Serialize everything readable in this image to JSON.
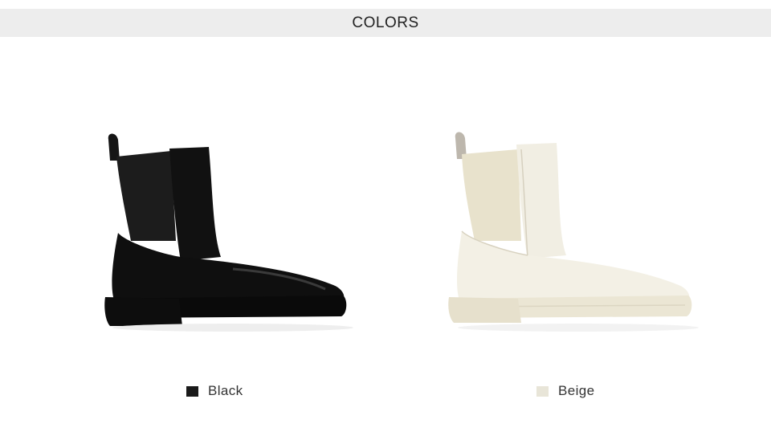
{
  "header": {
    "title": "COLORS"
  },
  "colors": [
    {
      "label": "Black",
      "swatch": "#1a1a1a",
      "product_icon": "black-chelsea-boot-image"
    },
    {
      "label": "Beige",
      "swatch": "#e8e5d8",
      "product_icon": "beige-chelsea-boot-image"
    }
  ]
}
